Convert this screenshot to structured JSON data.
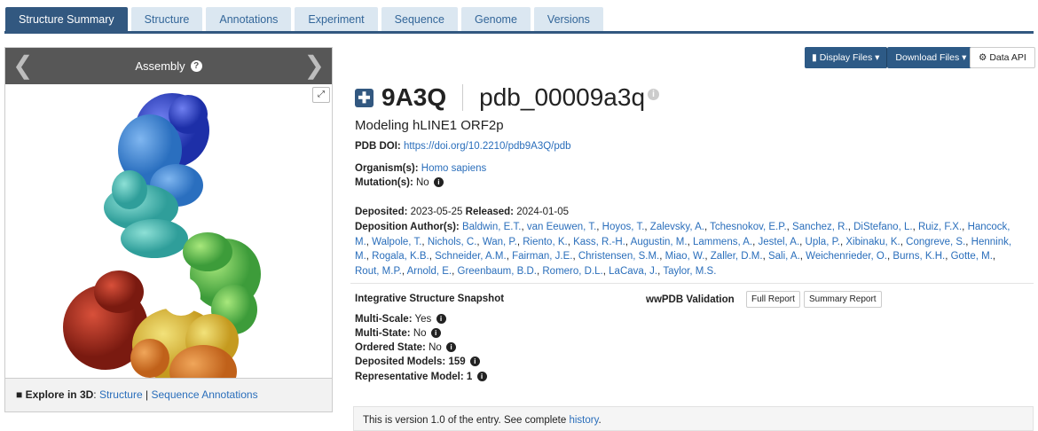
{
  "tabs": [
    "Structure Summary",
    "Structure",
    "Annotations",
    "Experiment",
    "Sequence",
    "Genome",
    "Versions"
  ],
  "viewer": {
    "title": "Assembly",
    "prev_arrow": "❮",
    "next_arrow": "❯",
    "footer_label": "Explore in 3D",
    "footer_colon": ":",
    "footer_link1": "Structure",
    "footer_sep": "|",
    "footer_link2": "Sequence Annotations"
  },
  "toolbar": {
    "display_files": "Display Files",
    "download_files": "Download Files",
    "data_api": "Data API"
  },
  "entry": {
    "id": "9A3Q",
    "alt_id": "pdb_00009a3q",
    "title": "Modeling hLINE1 ORF2p",
    "doi_label": "PDB DOI:",
    "doi": "https://doi.org/10.2210/pdb9A3Q/pdb",
    "organism_label": "Organism(s):",
    "organism": "Homo sapiens",
    "mutation_label": "Mutation(s):",
    "mutation": "No",
    "deposited_label": "Deposited:",
    "deposited": "2023-05-25",
    "released_label": "Released:",
    "released": "2024-01-05",
    "authors_label": "Deposition Author(s):",
    "authors": [
      "Baldwin, E.T.",
      "van Eeuwen, T.",
      "Hoyos, T.",
      "Zalevsky, A.",
      "Tchesnokov, E.P.",
      "Sanchez, R.",
      "DiStefano, L.",
      "Ruiz, F.X.",
      "Hancock, M.",
      "Walpole, T.",
      "Nichols, C.",
      "Wan, P.",
      "Riento, K.",
      "Kass, R.-H.",
      "Augustin, M.",
      "Lammens, A.",
      "Jestel, A.",
      "Upla, P.",
      "Xibinaku, K.",
      "Congreve, S.",
      "Hennink, M.",
      "Rogala, K.B.",
      "Schneider, A.M.",
      "Fairman, J.E.",
      "Christensen, S.M.",
      "Miao, W.",
      "Zaller, D.M.",
      "Sali, A.",
      "Weichenrieder, O.",
      "Burns, K.H.",
      "Gotte, M.",
      "Rout, M.P.",
      "Arnold, E.",
      "Greenbaum, B.D.",
      "Romero, D.L.",
      "LaCava, J.",
      "Taylor, M.S."
    ]
  },
  "snapshot": {
    "heading": "Integrative Structure Snapshot",
    "multiscale_label": "Multi-Scale:",
    "multiscale": "Yes",
    "multistate_label": "Multi-State:",
    "multistate": "No",
    "ordered_label": "Ordered State:",
    "ordered": "No",
    "models_label": "Deposited Models:",
    "models": "159",
    "rep_label": "Representative Model:",
    "rep": "1"
  },
  "validation": {
    "heading": "wwPDB Validation",
    "full_report": "Full Report",
    "summary_report": "Summary Report"
  },
  "version_note": {
    "text": "This is version 1.0 of the entry. See complete ",
    "link": "history",
    "end": "."
  }
}
